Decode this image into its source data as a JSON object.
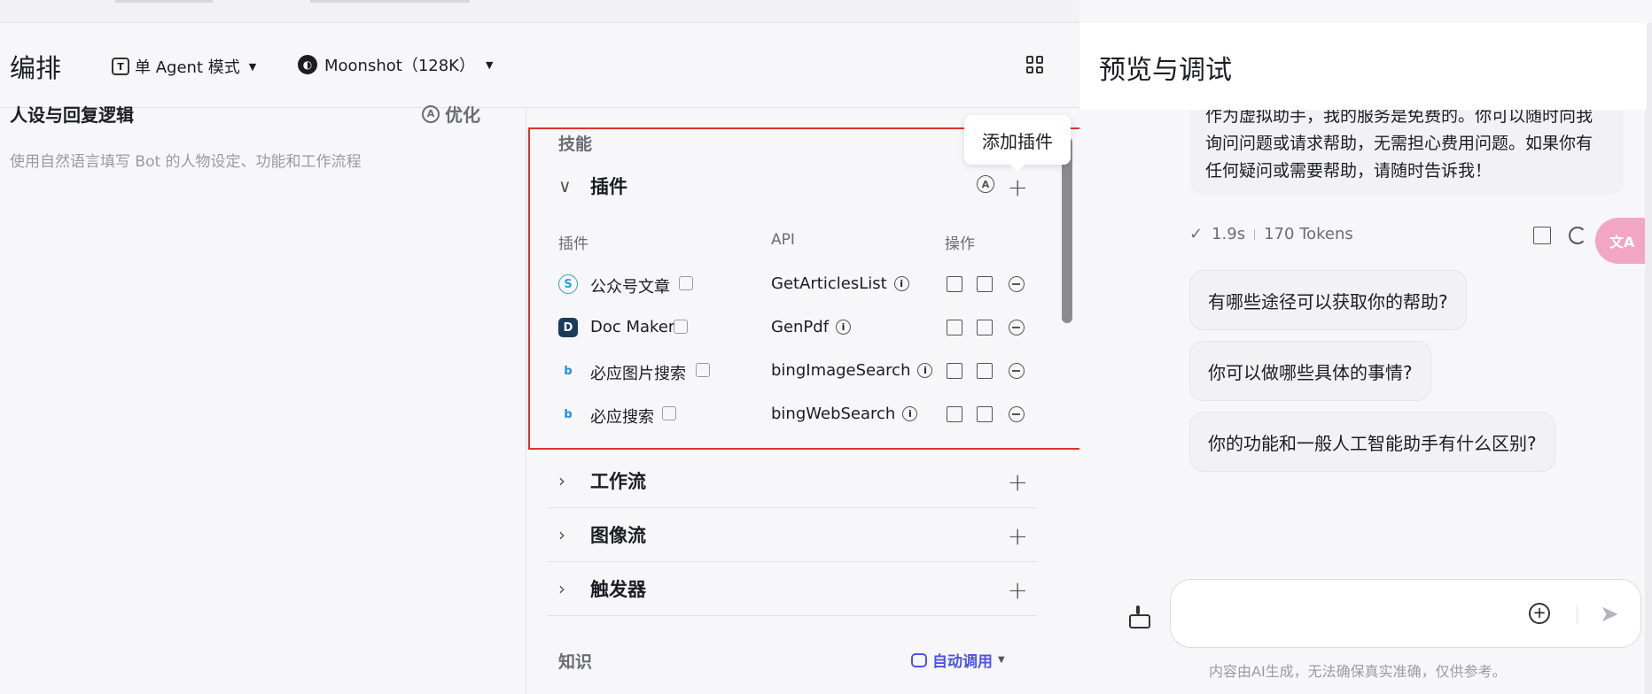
{
  "header": {
    "title": "编排",
    "mode_label": "单 Agent 模式",
    "model_label": "Moonshot（128K）"
  },
  "persona": {
    "title": "人设与回复逻辑",
    "optimize_label": "优化",
    "placeholder": "使用自然语言填写 Bot 的人物设定、功能和工作流程"
  },
  "skills": {
    "label": "技能",
    "plugins": {
      "title": "插件",
      "tooltip": "添加插件",
      "columns": [
        "插件",
        "API",
        "操作"
      ],
      "rows": [
        {
          "name": "公众号文章",
          "api": "GetArticlesList",
          "icon": "wechat-articles-icon",
          "color": "#2fa3c8"
        },
        {
          "name": "Doc Maker",
          "api": "GenPdf",
          "icon": "doc-maker-icon",
          "color": "#1c3b5a"
        },
        {
          "name": "必应图片搜索",
          "api": "bingImageSearch",
          "icon": "bing-icon",
          "color": "#1e8ee6"
        },
        {
          "name": "必应搜索",
          "api": "bingWebSearch",
          "icon": "bing-icon",
          "color": "#1e8ee6"
        }
      ]
    },
    "workflow": {
      "title": "工作流"
    },
    "imageflow": {
      "title": "图像流"
    },
    "trigger": {
      "title": "触发器"
    }
  },
  "knowledge": {
    "label": "知识",
    "auto_label": "自动调用"
  },
  "preview": {
    "title": "预览与调试",
    "bot_message": "作为虚拟助手，我的服务是免费的。你可以随时向我询问问题或请求帮助，无需担心费用问题。如果你有任何疑问或需要帮助，请随时告诉我！",
    "time": "1.9s",
    "tokens": "170 Tokens",
    "suggestions": [
      "有哪些途径可以获取你的帮助?",
      "你可以做哪些具体的事情?",
      "你的功能和一般人工智能助手有什么区别?"
    ],
    "disclaimer": "内容由AI生成，无法确保真实准确，仅供参考。"
  },
  "colors": {
    "highlight": "#e03131",
    "accent": "#4d53e8"
  }
}
